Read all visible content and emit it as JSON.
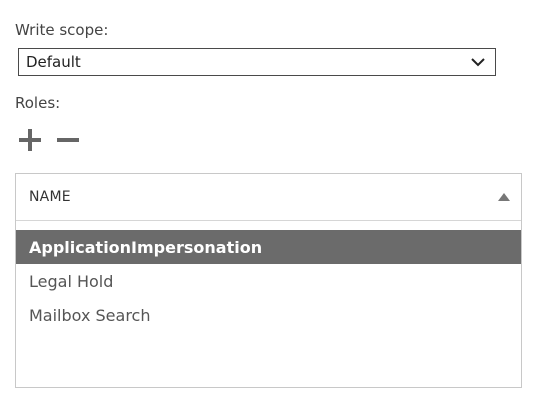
{
  "write_scope": {
    "label": "Write scope:",
    "selected": "Default"
  },
  "roles": {
    "label": "Roles:",
    "add_icon": "plus-icon",
    "remove_icon": "minus-icon"
  },
  "grid": {
    "column_header": "NAME",
    "sort_icon": "sort-ascending-icon",
    "rows": [
      {
        "name": "ApplicationImpersonation",
        "selected": true
      },
      {
        "name": "Legal Hold",
        "selected": false
      },
      {
        "name": "Mailbox Search",
        "selected": false
      }
    ]
  },
  "colors": {
    "selected_row_bg": "#6b6b6b",
    "selected_row_text": "#ffffff",
    "icon_gray": "#666666"
  }
}
